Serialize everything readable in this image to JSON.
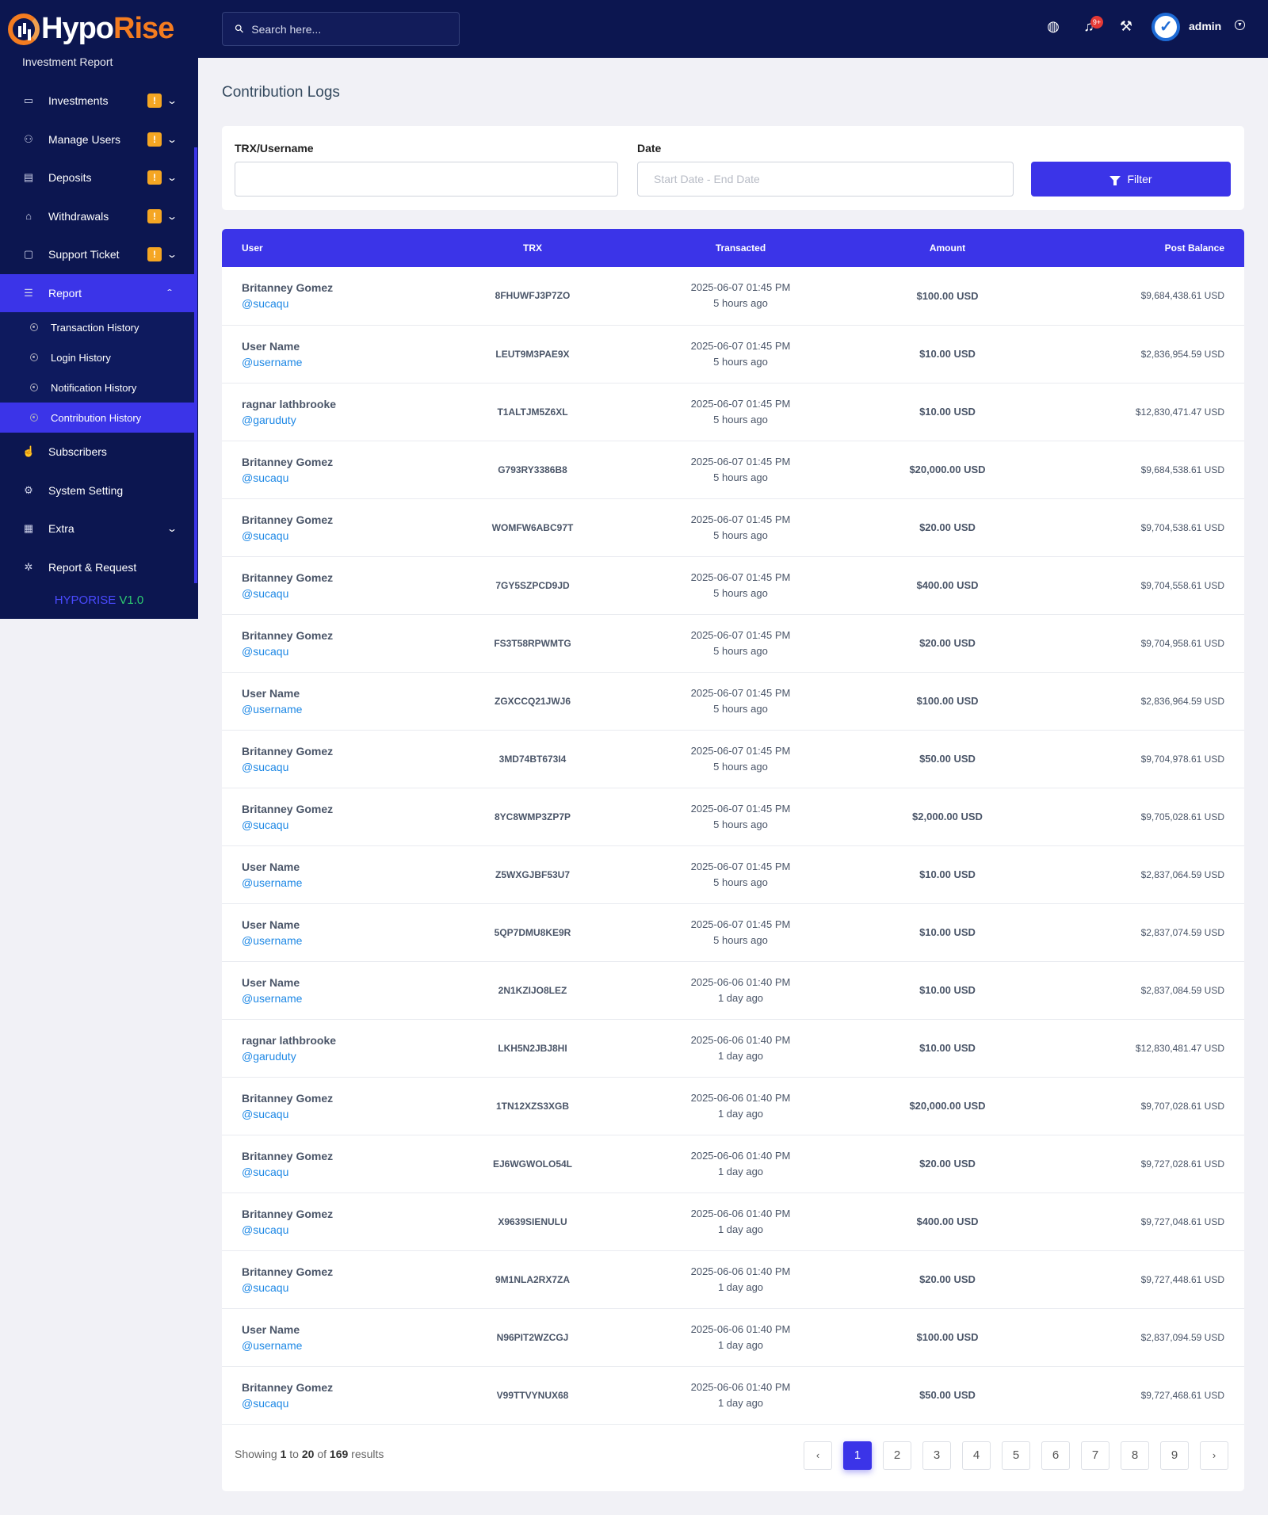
{
  "brand": {
    "part1": "Hypo",
    "part2": "Rise"
  },
  "sidebar": {
    "clipped_item": "Investment Report",
    "items": [
      {
        "label": "Investments",
        "icon": "wallet-icon",
        "badge": "!",
        "expandable": true
      },
      {
        "label": "Manage Users",
        "icon": "users-icon",
        "badge": "!",
        "expandable": true
      },
      {
        "label": "Deposits",
        "icon": "deposit-icon",
        "badge": "!",
        "expandable": true
      },
      {
        "label": "Withdrawals",
        "icon": "bank-icon",
        "badge": "!",
        "expandable": true
      },
      {
        "label": "Support Ticket",
        "icon": "ticket-icon",
        "badge": "!",
        "expandable": true
      },
      {
        "label": "Report",
        "icon": "list-icon",
        "active": true
      }
    ],
    "report_sub": [
      {
        "label": "Transaction History"
      },
      {
        "label": "Login History"
      },
      {
        "label": "Notification History"
      },
      {
        "label": "Contribution History",
        "active": true
      }
    ],
    "items_after": [
      {
        "label": "Subscribers",
        "icon": "thumbs-up-icon"
      },
      {
        "label": "System Setting",
        "icon": "settings-icon"
      },
      {
        "label": "Extra",
        "icon": "server-icon",
        "expandable": true
      },
      {
        "label": "Report & Request",
        "icon": "bug-icon"
      }
    ],
    "version": {
      "name": "HYPORISE",
      "number": "V1.0"
    }
  },
  "topbar": {
    "search_placeholder": "Search here...",
    "notification_count": "9+",
    "user": "admin"
  },
  "page": {
    "title": "Contribution Logs"
  },
  "filter": {
    "trx_label": "TRX/Username",
    "trx_value": "",
    "date_label": "Date",
    "date_placeholder": "Start Date - End Date",
    "button": "Filter"
  },
  "table": {
    "headers": {
      "user": "User",
      "trx": "TRX",
      "transacted": "Transacted",
      "amount": "Amount",
      "balance": "Post Balance"
    },
    "rows": [
      {
        "name": "Britanney Gomez",
        "handle": "@sucaqu",
        "trx": "8FHUWFJ3P7ZO",
        "date": "2025-06-07 01:45 PM",
        "ago": "5 hours ago",
        "amount": "$100.00 USD",
        "balance": "$9,684,438.61 USD"
      },
      {
        "name": "User Name",
        "handle": "@username",
        "trx": "LEUT9M3PAE9X",
        "date": "2025-06-07 01:45 PM",
        "ago": "5 hours ago",
        "amount": "$10.00 USD",
        "balance": "$2,836,954.59 USD"
      },
      {
        "name": "ragnar lathbrooke",
        "handle": "@garuduty",
        "trx": "T1ALTJM5Z6XL",
        "date": "2025-06-07 01:45 PM",
        "ago": "5 hours ago",
        "amount": "$10.00 USD",
        "balance": "$12,830,471.47 USD"
      },
      {
        "name": "Britanney Gomez",
        "handle": "@sucaqu",
        "trx": "G793RY3386B8",
        "date": "2025-06-07 01:45 PM",
        "ago": "5 hours ago",
        "amount": "$20,000.00 USD",
        "balance": "$9,684,538.61 USD"
      },
      {
        "name": "Britanney Gomez",
        "handle": "@sucaqu",
        "trx": "WOMFW6ABC97T",
        "date": "2025-06-07 01:45 PM",
        "ago": "5 hours ago",
        "amount": "$20.00 USD",
        "balance": "$9,704,538.61 USD"
      },
      {
        "name": "Britanney Gomez",
        "handle": "@sucaqu",
        "trx": "7GY5SZPCD9JD",
        "date": "2025-06-07 01:45 PM",
        "ago": "5 hours ago",
        "amount": "$400.00 USD",
        "balance": "$9,704,558.61 USD"
      },
      {
        "name": "Britanney Gomez",
        "handle": "@sucaqu",
        "trx": "FS3T58RPWMTG",
        "date": "2025-06-07 01:45 PM",
        "ago": "5 hours ago",
        "amount": "$20.00 USD",
        "balance": "$9,704,958.61 USD"
      },
      {
        "name": "User Name",
        "handle": "@username",
        "trx": "ZGXCCQ21JWJ6",
        "date": "2025-06-07 01:45 PM",
        "ago": "5 hours ago",
        "amount": "$100.00 USD",
        "balance": "$2,836,964.59 USD"
      },
      {
        "name": "Britanney Gomez",
        "handle": "@sucaqu",
        "trx": "3MD74BT673I4",
        "date": "2025-06-07 01:45 PM",
        "ago": "5 hours ago",
        "amount": "$50.00 USD",
        "balance": "$9,704,978.61 USD"
      },
      {
        "name": "Britanney Gomez",
        "handle": "@sucaqu",
        "trx": "8YC8WMP3ZP7P",
        "date": "2025-06-07 01:45 PM",
        "ago": "5 hours ago",
        "amount": "$2,000.00 USD",
        "balance": "$9,705,028.61 USD"
      },
      {
        "name": "User Name",
        "handle": "@username",
        "trx": "Z5WXGJBF53U7",
        "date": "2025-06-07 01:45 PM",
        "ago": "5 hours ago",
        "amount": "$10.00 USD",
        "balance": "$2,837,064.59 USD"
      },
      {
        "name": "User Name",
        "handle": "@username",
        "trx": "5QP7DMU8KE9R",
        "date": "2025-06-07 01:45 PM",
        "ago": "5 hours ago",
        "amount": "$10.00 USD",
        "balance": "$2,837,074.59 USD"
      },
      {
        "name": "User Name",
        "handle": "@username",
        "trx": "2N1KZIJO8LEZ",
        "date": "2025-06-06 01:40 PM",
        "ago": "1 day ago",
        "amount": "$10.00 USD",
        "balance": "$2,837,084.59 USD"
      },
      {
        "name": "ragnar lathbrooke",
        "handle": "@garuduty",
        "trx": "LKH5N2JBJ8HI",
        "date": "2025-06-06 01:40 PM",
        "ago": "1 day ago",
        "amount": "$10.00 USD",
        "balance": "$12,830,481.47 USD"
      },
      {
        "name": "Britanney Gomez",
        "handle": "@sucaqu",
        "trx": "1TN12XZS3XGB",
        "date": "2025-06-06 01:40 PM",
        "ago": "1 day ago",
        "amount": "$20,000.00 USD",
        "balance": "$9,707,028.61 USD"
      },
      {
        "name": "Britanney Gomez",
        "handle": "@sucaqu",
        "trx": "EJ6WGWOLO54L",
        "date": "2025-06-06 01:40 PM",
        "ago": "1 day ago",
        "amount": "$20.00 USD",
        "balance": "$9,727,028.61 USD"
      },
      {
        "name": "Britanney Gomez",
        "handle": "@sucaqu",
        "trx": "X9639SIENULU",
        "date": "2025-06-06 01:40 PM",
        "ago": "1 day ago",
        "amount": "$400.00 USD",
        "balance": "$9,727,048.61 USD"
      },
      {
        "name": "Britanney Gomez",
        "handle": "@sucaqu",
        "trx": "9M1NLA2RX7ZA",
        "date": "2025-06-06 01:40 PM",
        "ago": "1 day ago",
        "amount": "$20.00 USD",
        "balance": "$9,727,448.61 USD"
      },
      {
        "name": "User Name",
        "handle": "@username",
        "trx": "N96PIT2WZCGJ",
        "date": "2025-06-06 01:40 PM",
        "ago": "1 day ago",
        "amount": "$100.00 USD",
        "balance": "$2,837,094.59 USD"
      },
      {
        "name": "Britanney Gomez",
        "handle": "@sucaqu",
        "trx": "V99TTVYNUX68",
        "date": "2025-06-06 01:40 PM",
        "ago": "1 day ago",
        "amount": "$50.00 USD",
        "balance": "$9,727,468.61 USD"
      }
    ]
  },
  "pagination": {
    "showing": "Showing",
    "from": "1",
    "to_word": "to",
    "to": "20",
    "of_word": "of",
    "total": "169",
    "results": "results",
    "pages": [
      "1",
      "2",
      "3",
      "4",
      "5",
      "6",
      "7",
      "8",
      "9"
    ],
    "current": "1",
    "prev": "‹",
    "next": "›"
  },
  "colors": {
    "primary": "#3b34e8",
    "navy": "#0c1650",
    "badge": "#f5a623",
    "link": "#1e88e5",
    "brand_orange": "#f47c20"
  }
}
